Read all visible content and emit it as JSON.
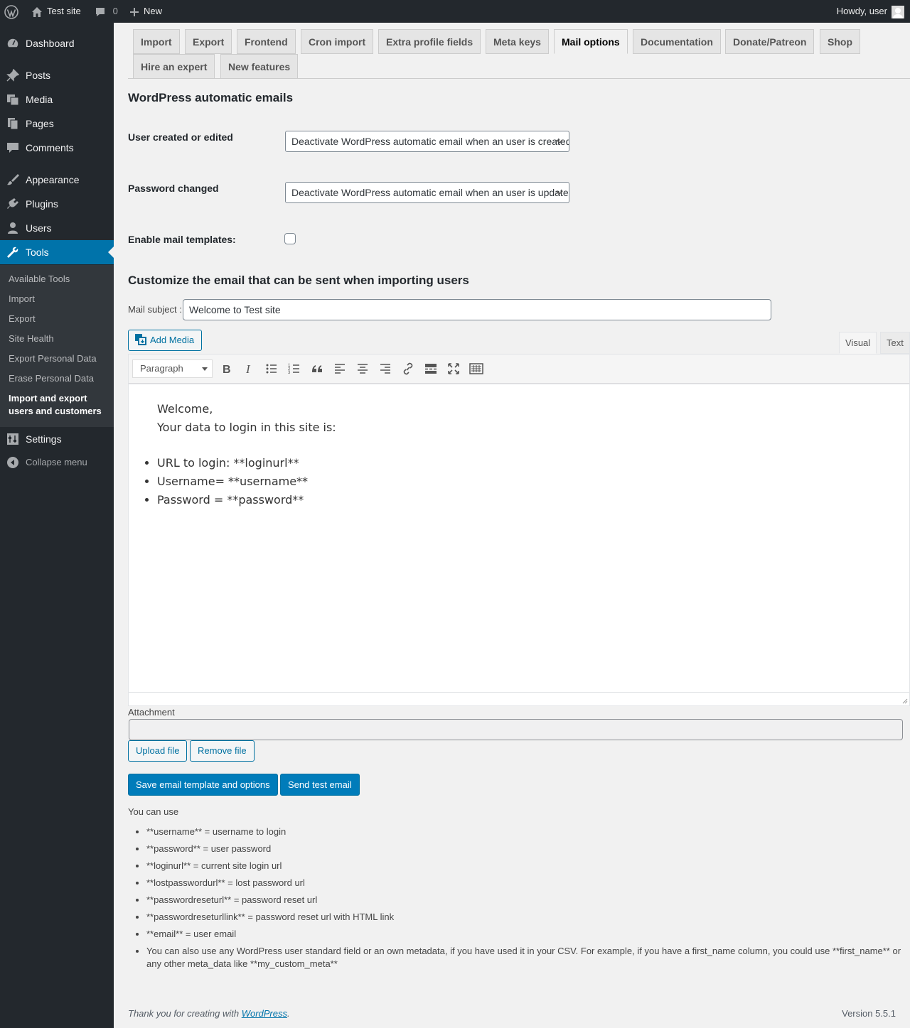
{
  "adminbar": {
    "site_name": "Test site",
    "comments_count": "0",
    "new_label": "New",
    "howdy": "Howdy, user"
  },
  "menu": {
    "dashboard": "Dashboard",
    "posts": "Posts",
    "media": "Media",
    "pages": "Pages",
    "comments": "Comments",
    "appearance": "Appearance",
    "plugins": "Plugins",
    "users": "Users",
    "tools": "Tools",
    "settings": "Settings",
    "collapse": "Collapse menu",
    "submenu": [
      "Available Tools",
      "Import",
      "Export",
      "Site Health",
      "Export Personal Data",
      "Erase Personal Data",
      "Import and export users and customers"
    ]
  },
  "tabs": [
    "Import",
    "Export",
    "Frontend",
    "Cron import",
    "Extra profile fields",
    "Meta keys",
    "Mail options",
    "Documentation",
    "Donate/Patreon",
    "Shop",
    "Hire an expert",
    "New features"
  ],
  "active_tab": "Mail options",
  "section1": {
    "title": "WordPress automatic emails",
    "user_created_label": "User created or edited",
    "user_created_value": "Deactivate WordPress automatic email when an user is created or edited",
    "password_changed_label": "Password changed",
    "password_changed_value": "Deactivate WordPress automatic email when an user is updated or password changed",
    "enable_templates_label": "Enable mail templates:",
    "enable_templates_checked": false
  },
  "section2": {
    "title": "Customize the email that can be sent when importing users",
    "subject_label": "Mail subject :",
    "subject_value": "Welcome to Test site",
    "add_media": "Add Media",
    "tab_visual": "Visual",
    "tab_text": "Text",
    "format_select": "Paragraph",
    "body_line1": "Welcome,",
    "body_line2": "Your data to login in this site is:",
    "body_items": [
      "URL to login: **loginurl**",
      "Username= **username**",
      "Password = **password**"
    ],
    "attachment_label": "Attachment",
    "attachment_value": "",
    "upload_file": "Upload file",
    "remove_file": "Remove file",
    "save_button": "Save email template and options",
    "test_button": "Send test email"
  },
  "help": {
    "intro": "You can use",
    "items": [
      "**username** = username to login",
      "**password** = user password",
      "**loginurl** = current site login url",
      "**lostpasswordurl** = lost password url",
      "**passwordreseturl** = password reset url",
      "**passwordreseturllink** = password reset url with HTML link",
      "**email** = user email",
      "You can also use any WordPress user standard field or an own metadata, if you have used it in your CSV. For example, if you have a first_name column, you could use **first_name** or any other meta_data like **my_custom_meta**"
    ]
  },
  "footer": {
    "thanks_prefix": "Thank you for creating with ",
    "thanks_link": "WordPress",
    "thanks_suffix": ".",
    "version": "Version 5.5.1"
  },
  "colors": {
    "admin_bar": "#23282d",
    "menu_bg": "#23282d",
    "submenu_bg": "#32373c",
    "accent": "#0073aa",
    "primary_button": "#007cba"
  }
}
